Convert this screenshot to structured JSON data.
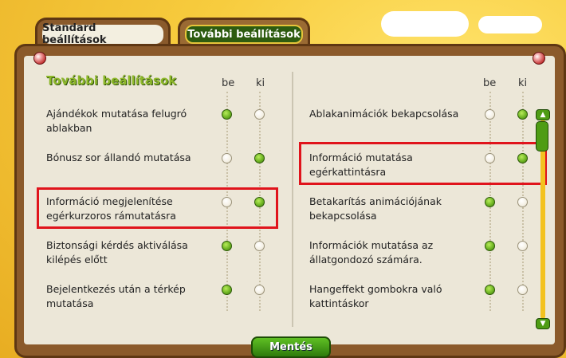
{
  "tabs": [
    {
      "label": "Standard beállítások",
      "active": false
    },
    {
      "label": "További beállítások",
      "active": true
    }
  ],
  "section_title": "További beállítások",
  "columns": {
    "on": "be",
    "off": "ki"
  },
  "left_rows": [
    {
      "label_line1": "Ajándékok mutatása felugró",
      "label_line2": "ablakban",
      "value": "be"
    },
    {
      "label_line1": "Bónusz sor állandó mutatása",
      "label_line2": "",
      "value": "ki"
    },
    {
      "label_line1": "Információ megjelenítése",
      "label_line2": "egérkurzoros rámutatásra",
      "value": "ki"
    },
    {
      "label_line1": "Biztonsági kérdés aktiválása",
      "label_line2": "kilépés előtt",
      "value": "be"
    },
    {
      "label_line1": "Bejelentkezés után a térkép",
      "label_line2": "mutatása",
      "value": "be"
    }
  ],
  "right_rows": [
    {
      "label_line1": "Ablakanimációk bekapcsolása",
      "label_line2": "",
      "value": "ki"
    },
    {
      "label_line1": "Információ mutatása",
      "label_line2": "egérkattintásra",
      "value": "ki"
    },
    {
      "label_line1": "Betakarítás animációjának",
      "label_line2": "bekapcsolása",
      "value": "be"
    },
    {
      "label_line1": "Információk mutatása az",
      "label_line2": "állatgondozó számára.",
      "value": "be"
    },
    {
      "label_line1": "Hangeffekt gombokra való",
      "label_line2": "kattintáskor",
      "value": "be"
    }
  ],
  "save_label": "Mentés",
  "icons": {
    "scroll_up": "chevron-up-icon",
    "scroll_down": "chevron-down-icon",
    "pin": "pin-icon"
  },
  "colors": {
    "highlight": "#e0141c",
    "selected_radio": "#6fb524",
    "title_green": "#8db82a"
  }
}
